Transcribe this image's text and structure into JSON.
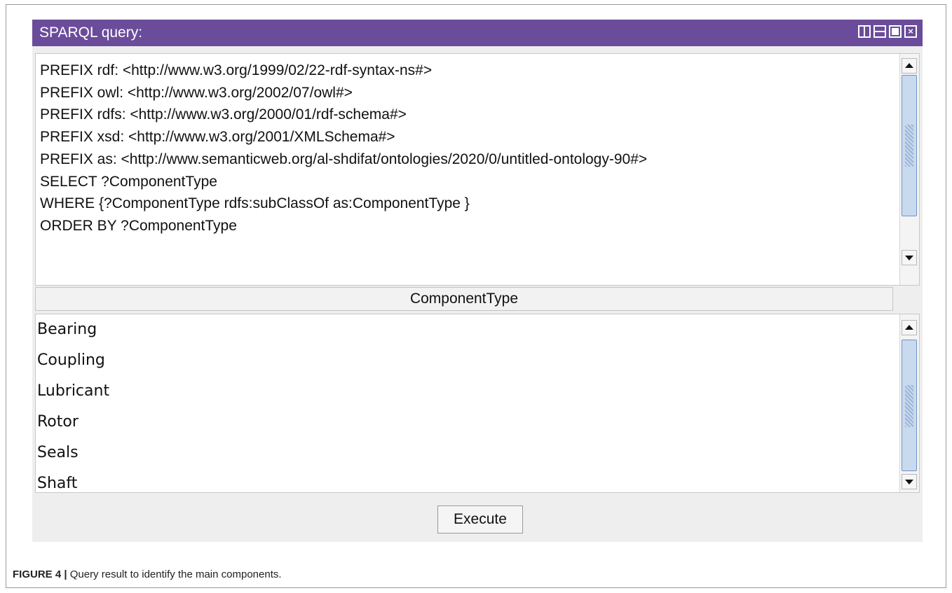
{
  "window": {
    "title": "SPARQL query:",
    "controls": [
      "split-vertical-icon",
      "split-horizontal-icon",
      "maximize-icon",
      "close-icon"
    ],
    "titlebar_color": "#6b4c9a"
  },
  "query": {
    "lines": [
      "PREFIX rdf: <http://www.w3.org/1999/02/22-rdf-syntax-ns#>",
      "PREFIX owl: <http://www.w3.org/2002/07/owl#>",
      "PREFIX rdfs: <http://www.w3.org/2000/01/rdf-schema#>",
      "PREFIX xsd: <http://www.w3.org/2001/XMLSchema#>",
      "PREFIX as: <http://www.semanticweb.org/al-shdifat/ontologies/2020/0/untitled-ontology-90#>",
      "SELECT  ?ComponentType",
      "WHERE {?ComponentType rdfs:subClassOf as:ComponentType }",
      "ORDER BY ?ComponentType"
    ]
  },
  "results": {
    "column_header": "ComponentType",
    "rows": [
      "Bearing",
      "Coupling",
      "Lubricant",
      "Rotor",
      "Seals",
      "Shaft"
    ]
  },
  "actions": {
    "execute_label": "Execute"
  },
  "caption": {
    "label": "FIGURE 4 |",
    "text": " Query result to identify the main components."
  }
}
